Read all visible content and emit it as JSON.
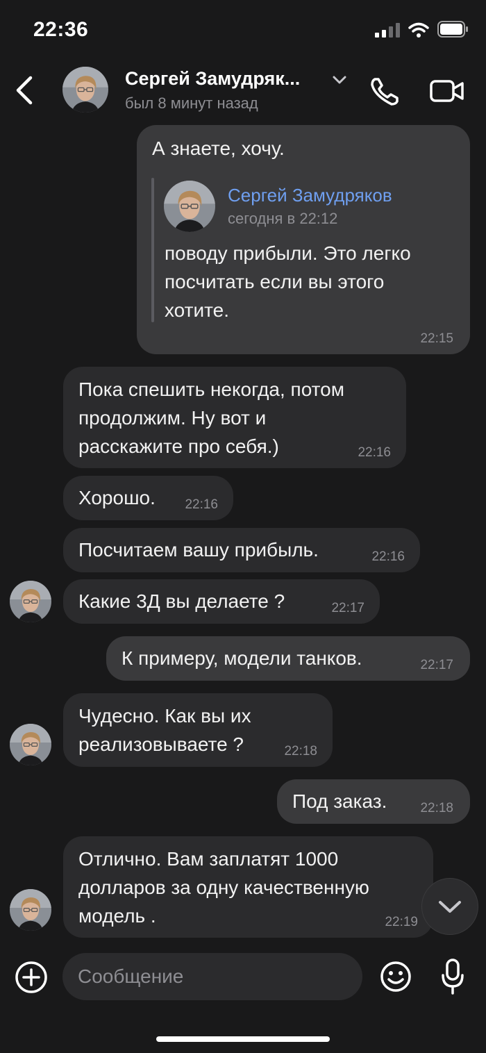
{
  "status_bar": {
    "time": "22:36"
  },
  "header": {
    "contact_name": "Сергей Замудряк...",
    "last_seen": "был 8 минут назад"
  },
  "messages": [
    {
      "direction": "outgoing",
      "text_lines": [
        "А знаете, хочу."
      ],
      "quote": {
        "author": "Сергей Замудряков",
        "date": "сегодня в 22:12",
        "text_lines": [
          "поводу прибыли. Это легко",
          "посчитать если вы этого",
          "хотите."
        ]
      },
      "time": "22:15"
    },
    {
      "direction": "incoming",
      "text_lines": [
        "Пока спешить некогда, потом",
        "продолжим. Ну вот и",
        "расскажите про себя.)"
      ],
      "time": "22:16"
    },
    {
      "direction": "incoming",
      "text_lines": [
        "Хорошо."
      ],
      "time": "22:16"
    },
    {
      "direction": "incoming",
      "text_lines": [
        "Посчитаем вашу прибыль."
      ],
      "time": "22:16"
    },
    {
      "direction": "incoming",
      "text_lines": [
        "Какие 3Д вы делаете ?"
      ],
      "time": "22:17"
    },
    {
      "direction": "outgoing",
      "text_lines": [
        "К примеру, модели танков."
      ],
      "time": "22:17"
    },
    {
      "direction": "incoming",
      "text_lines": [
        "Чудесно. Как вы их",
        "реализовываете ?"
      ],
      "time": "22:18"
    },
    {
      "direction": "outgoing",
      "text_lines": [
        "Под заказ."
      ],
      "time": "22:18"
    },
    {
      "direction": "incoming",
      "text_lines": [
        "Отлично. Вам заплатят 1000",
        "долларов за одну качественную",
        "модель ."
      ],
      "time": "22:19"
    }
  ],
  "composer": {
    "placeholder": "Сообщение"
  },
  "icons": {
    "back": "chevron-left-icon",
    "dropdown": "chevron-down-icon",
    "call": "phone-icon",
    "video": "video-camera-icon",
    "attach": "plus-circle-icon",
    "emoji": "smiley-icon",
    "mic": "microphone-icon",
    "scroll": "chevron-down-icon"
  },
  "colors": {
    "background": "#19191a",
    "incoming_bubble": "#2b2b2d",
    "outgoing_bubble": "#3a3a3c",
    "quote_author": "#6f9ff0",
    "secondary_text": "#8e8e93"
  }
}
